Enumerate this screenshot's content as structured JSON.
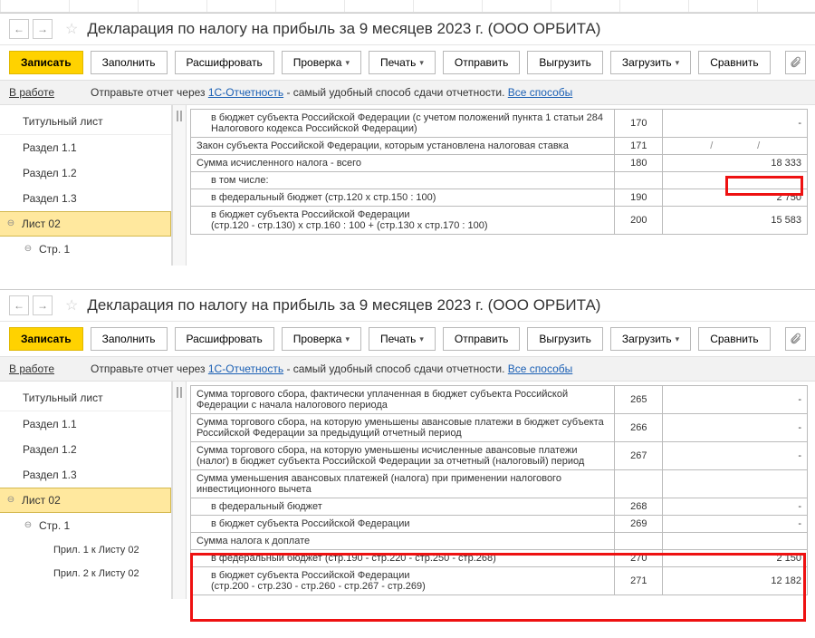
{
  "title": "Декларация по налогу на прибыль за 9 месяцев 2023 г. (ООО ОРБИТА)",
  "toolbar": {
    "save": "Записать",
    "fill": "Заполнить",
    "decode": "Расшифровать",
    "check": "Проверка",
    "print": "Печать",
    "send": "Отправить",
    "export": "Выгрузить",
    "import": "Загрузить",
    "compare": "Сравнить"
  },
  "info": {
    "status": "В работе",
    "text1": "Отправьте отчет через ",
    "link1": "1С-Отчетность",
    "text2": " - самый удобный способ сдачи отчетности. ",
    "link2": "Все способы"
  },
  "sidebar": {
    "title": "Титульный лист",
    "s11": "Раздел 1.1",
    "s12": "Раздел 1.2",
    "s13": "Раздел 1.3",
    "list02": "Лист 02",
    "str1": "Стр. 1",
    "app1": "Прил. 1 к Листу 02",
    "app2": "Прил. 2 к Листу 02"
  },
  "rows1": {
    "r170": {
      "desc": "в бюджет субъекта Российской Федерации (с учетом положений пункта 1 статьи 284 Налогового кодекса Российской Федерации)",
      "code": "170",
      "val": "-"
    },
    "r171": {
      "desc": "Закон субъекта Российской Федерации, которым установлена налоговая ставка",
      "code": "171"
    },
    "r180": {
      "desc": "Сумма исчисленного налога - всего",
      "code": "180",
      "val": "18 333"
    },
    "sub": "в том числе:",
    "r190": {
      "desc": "в федеральный бюджет (стр.120 х стр.150 : 100)",
      "code": "190",
      "val": "2 750"
    },
    "r200": {
      "desc": "в бюджет субъекта Российской Федерации\n(стр.120 - стр.130) х стр.160 : 100 + (стр.130 х стр.170 : 100)",
      "code": "200",
      "val": "15 583"
    }
  },
  "rows2": {
    "r265": {
      "desc": "Сумма торгового сбора, фактически уплаченная в бюджет субъекта Российской Федерации с начала налогового периода",
      "code": "265",
      "val": "-"
    },
    "r266": {
      "desc": "Сумма торгового сбора, на которую уменьшены авансовые платежи в бюджет субъекта Российской Федерации за предыдущий отчетный период",
      "code": "266",
      "val": "-"
    },
    "r267": {
      "desc": "Сумма торгового сбора, на которую уменьшены исчисленные авансовые платежи (налог) в бюджет субъекта Российской Федерации за отчетный (налоговый) период",
      "code": "267",
      "val": "-"
    },
    "rInvest": {
      "desc": "Сумма уменьшения авансовых платежей (налога) при применении налогового инвестиционного вычета"
    },
    "r268": {
      "desc": "в федеральный бюджет",
      "code": "268",
      "val": "-"
    },
    "r269": {
      "desc": "в бюджет субъекта Российской Федерации",
      "code": "269",
      "val": "-"
    },
    "rExtra": {
      "desc": "Сумма налога к доплате"
    },
    "r270": {
      "desc": "в федеральный бюджет (стр.190 - стр.220 - стр.250 - стр.268)",
      "code": "270",
      "val": "2 150"
    },
    "r271": {
      "desc": "в бюджет субъекта Российской Федерации\n(стр.200 - стр.230 - стр.260 - стр.267 - стр.269)",
      "code": "271",
      "val": "12 182"
    }
  }
}
